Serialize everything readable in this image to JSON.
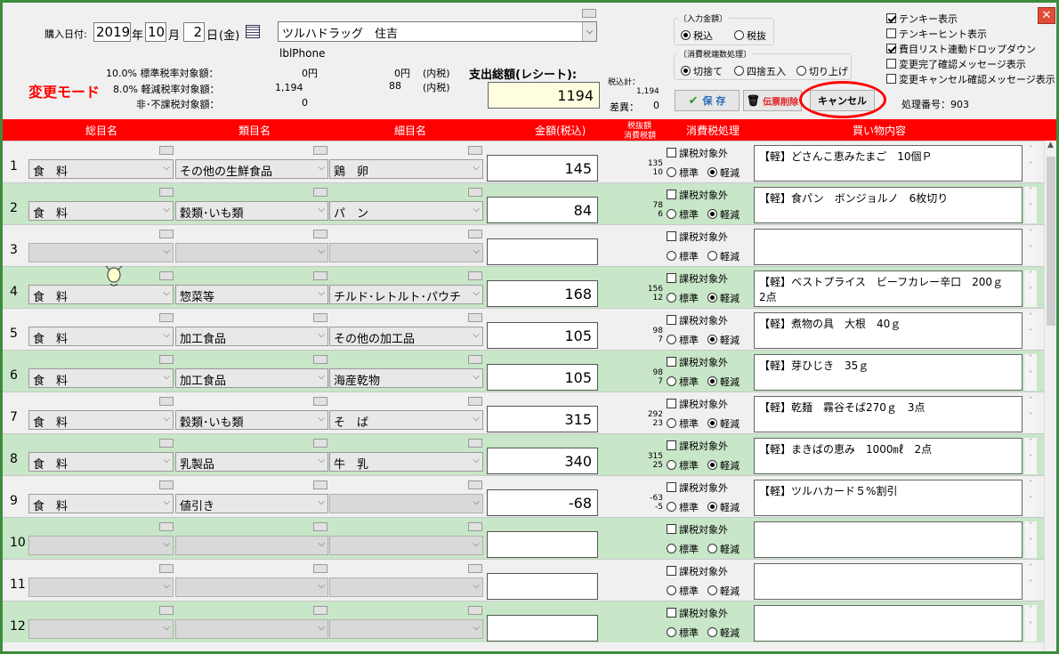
{
  "header": {
    "purchase_date_label": "購入日付:",
    "year": "2019",
    "year_unit": "年",
    "month": "10",
    "month_unit": "月",
    "day": "2",
    "day_unit": "日",
    "weekday": "(金)",
    "store": "ツルハドラッグ　住吉",
    "lbl_phone": "lblPhone",
    "mode": "変更モード",
    "tax_lines": [
      {
        "label": "10.0% 標準税率対象額：",
        "v1": "0円",
        "v2": "0円",
        "v3": "(内税)"
      },
      {
        "label": "8.0% 軽減税率対象額：",
        "v1": "1,194",
        "v2": "88",
        "v3": "(内税)"
      },
      {
        "label": "非･不課税対象額：",
        "v1": "0",
        "v2": "",
        "v3": ""
      }
    ],
    "total_label": "支出総額(レシート):",
    "total_value": "1194",
    "taxin_total_label": "税込計：",
    "taxin_total_value": "1,194",
    "diff_label": "差異：",
    "diff_value": "0"
  },
  "input_amount": {
    "title": "〔入力金額〕",
    "opt_taxin": "税込",
    "opt_taxout": "税抜"
  },
  "rounding": {
    "title": "〔消費税端数処理〕",
    "opt_floor": "切捨て",
    "opt_round": "四捨五入",
    "opt_ceil": "切り上げ"
  },
  "buttons": {
    "save": "保 存",
    "delete": "伝票削除",
    "cancel": "キャンセル"
  },
  "options": {
    "tenkey": "テンキー表示",
    "tenkey_hint": "テンキーヒント表示",
    "expense_link": "費目リスト連動ドロップダウン",
    "confirm_change": "変更完了確認メッセージ表示",
    "confirm_cancel": "変更キャンセル確認メッセージ表示"
  },
  "process_label": "処理番号：903",
  "columns": {
    "c1": "総目名",
    "c2": "類目名",
    "c3": "細目名",
    "c4": "金額(税込)",
    "c5a": "税抜額",
    "c5b": "消費税額",
    "c6": "消費税処理",
    "c7": "買い物内容"
  },
  "row_labels": {
    "exempt": "課税対象外",
    "std": "標準",
    "reduced": "軽減"
  },
  "rows": [
    {
      "n": "1",
      "a": "食　料",
      "b": "その他の生鮮食品",
      "c": "鶏　卵",
      "amt": "145",
      "t1": "135",
      "t2": "10",
      "memo": "【軽】どさんこ恵みたまご　10個Ｐ"
    },
    {
      "n": "2",
      "a": "食　料",
      "b": "穀類･いも類",
      "c": "パ　ン",
      "amt": "84",
      "t1": "78",
      "t2": "6",
      "memo": "【軽】食パン　ボンジョルノ　6枚切り"
    },
    {
      "n": "3",
      "a": "",
      "b": "",
      "c": "",
      "amt": "",
      "t1": "",
      "t2": "",
      "memo": ""
    },
    {
      "n": "4",
      "a": "食　料",
      "b": "惣菜等",
      "c": "チルド･レトルト･パウチ",
      "amt": "168",
      "t1": "156",
      "t2": "12",
      "memo": "【軽】ベストプライス　ビーフカレー辛口　200ｇ　2点"
    },
    {
      "n": "5",
      "a": "食　料",
      "b": "加工食品",
      "c": "その他の加工品",
      "amt": "105",
      "t1": "98",
      "t2": "7",
      "memo": "【軽】煮物の具　大根　40ｇ"
    },
    {
      "n": "6",
      "a": "食　料",
      "b": "加工食品",
      "c": "海産乾物",
      "amt": "105",
      "t1": "98",
      "t2": "7",
      "memo": "【軽】芽ひじき　35ｇ"
    },
    {
      "n": "7",
      "a": "食　料",
      "b": "穀類･いも類",
      "c": "そ　ば",
      "amt": "315",
      "t1": "292",
      "t2": "23",
      "memo": "【軽】乾麺　霧谷そば270ｇ　3点"
    },
    {
      "n": "8",
      "a": "食　料",
      "b": "乳製品",
      "c": "牛　乳",
      "amt": "340",
      "t1": "315",
      "t2": "25",
      "memo": "【軽】まきばの恵み　1000㎖　2点"
    },
    {
      "n": "9",
      "a": "食　料",
      "b": "値引き",
      "c": "",
      "amt": "-68",
      "t1": "-63",
      "t2": "-5",
      "memo": "【軽】ツルハカード５%割引"
    },
    {
      "n": "10",
      "a": "",
      "b": "",
      "c": "",
      "amt": "",
      "t1": "",
      "t2": "",
      "memo": ""
    },
    {
      "n": "11",
      "a": "",
      "b": "",
      "c": "",
      "amt": "",
      "t1": "",
      "t2": "",
      "memo": ""
    },
    {
      "n": "12",
      "a": "",
      "b": "",
      "c": "",
      "amt": "",
      "t1": "",
      "t2": "",
      "memo": ""
    }
  ],
  "colors": {
    "header_red": "#ff0000",
    "row_green": "#c8e6c8",
    "frame_green": "#3c8c3c",
    "mode_red": "#ff0000"
  }
}
